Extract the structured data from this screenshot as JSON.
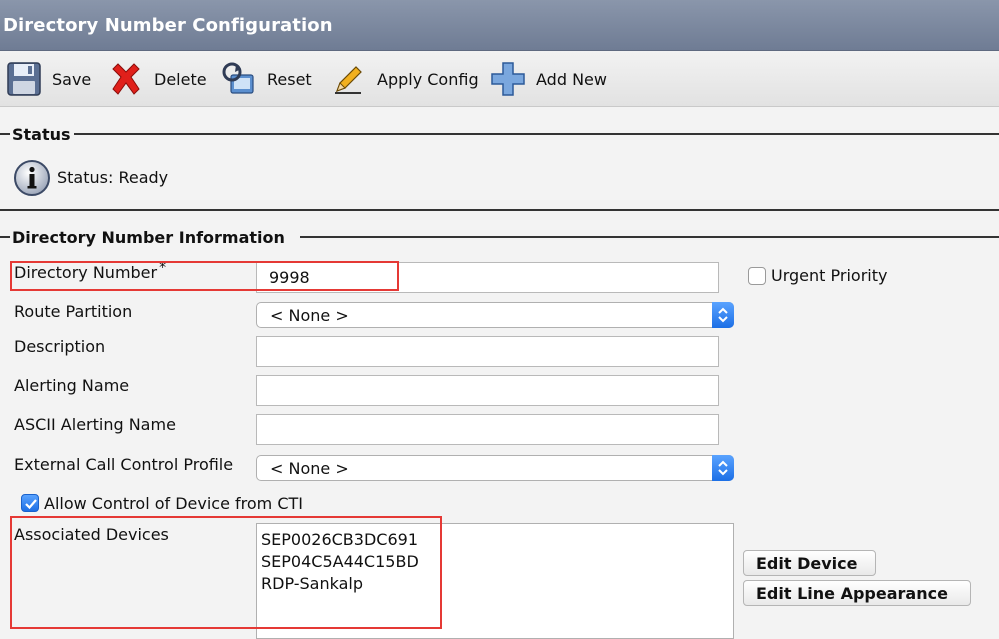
{
  "page": {
    "title": "Directory Number Configuration"
  },
  "toolbar": {
    "save": "Save",
    "delete": "Delete",
    "reset": "Reset",
    "apply_config": "Apply Config",
    "add_new": "Add New"
  },
  "status": {
    "heading": "Status",
    "text": "Status: Ready",
    "icon": "info-icon"
  },
  "dn_info": {
    "heading": "Directory Number Information",
    "directory_number": {
      "label": "Directory Number",
      "required_mark": "*",
      "value": "9998"
    },
    "urgent_priority": {
      "label": "Urgent Priority",
      "checked": false
    },
    "route_partition": {
      "label": "Route Partition",
      "value": "< None >"
    },
    "description": {
      "label": "Description",
      "value": ""
    },
    "alerting_name": {
      "label": "Alerting Name",
      "value": ""
    },
    "ascii_alerting_name": {
      "label": "ASCII Alerting Name",
      "value": ""
    },
    "external_call_control_profile": {
      "label": "External Call Control Profile",
      "value": "< None >"
    },
    "allow_cti": {
      "label": "Allow Control of Device from CTI",
      "checked": true
    },
    "associated_devices": {
      "label": "Associated Devices",
      "items": [
        "SEP0026CB3DC691",
        "SEP04C5A44C15BD",
        "RDP-Sankalp"
      ]
    },
    "edit_device": "Edit Device",
    "edit_line_appearance": "Edit Line Appearance"
  },
  "colors": {
    "titlebar": "#7b879d",
    "highlight": "#e53935",
    "accent_blue": "#1c6fe6"
  }
}
